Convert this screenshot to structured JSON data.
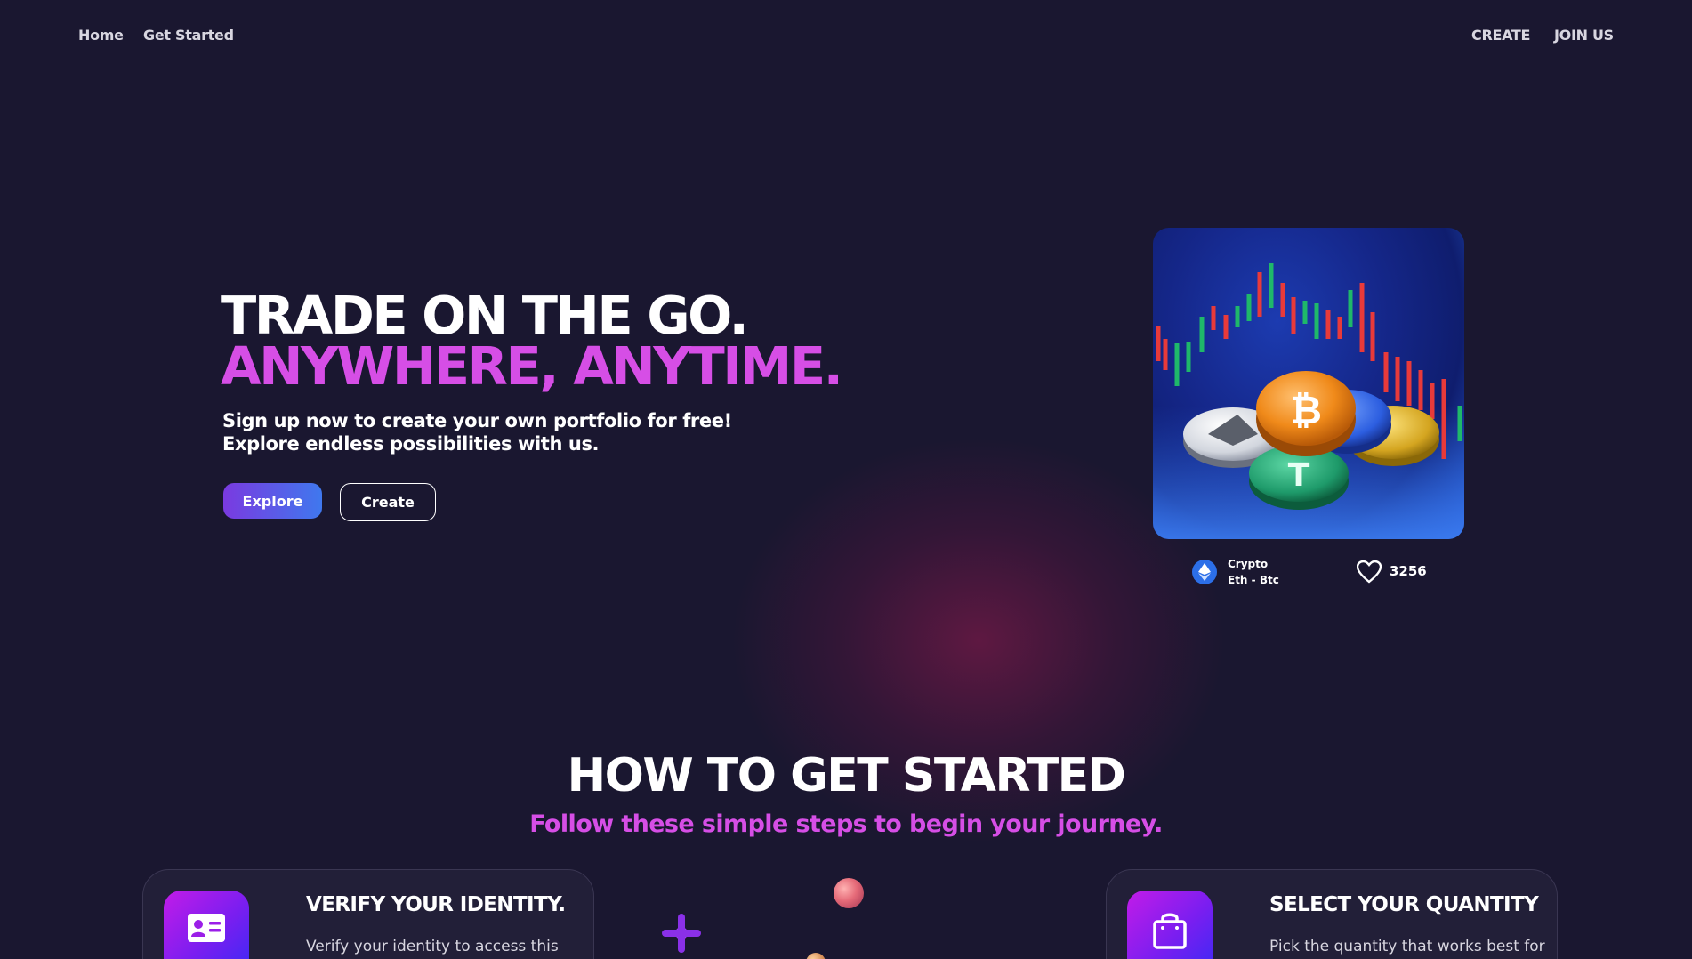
{
  "nav": {
    "home": "Home",
    "get_started": "Get Started",
    "create": "CREATE",
    "join_us": "JOIN US"
  },
  "hero": {
    "title_line1": "TRADE ON THE GO.",
    "title_line2": "ANYWHERE, ANYTIME.",
    "subtitle_line1": "Sign up now to create your own portfolio for free!",
    "subtitle_line2": "Explore endless possibilities with us.",
    "explore_label": "Explore",
    "create_label": "Create"
  },
  "card": {
    "image_icon": "crypto-coins-chart-image",
    "badge_icon": "ethereum-icon",
    "category": "Crypto",
    "pair": "Eth - Btc",
    "likes_icon": "heart-icon",
    "likes": "3256"
  },
  "section": {
    "title": "HOW TO GET STARTED",
    "subtitle": "Follow these simple steps to begin your journey.",
    "steps": [
      {
        "icon": "id-card-icon",
        "title": "VERIFY YOUR IDENTITY.",
        "text": "Verify your identity to access this"
      },
      {
        "icon": "shopping-bag-icon",
        "title": "SELECT YOUR QUANTITY",
        "text": "Pick the quantity that works best for"
      }
    ]
  },
  "colors": {
    "background": "#1a1730",
    "accent_pink": "#d64ee6",
    "explore_gradient_start": "#7a3ae0",
    "explore_gradient_end": "#3f78ee"
  }
}
